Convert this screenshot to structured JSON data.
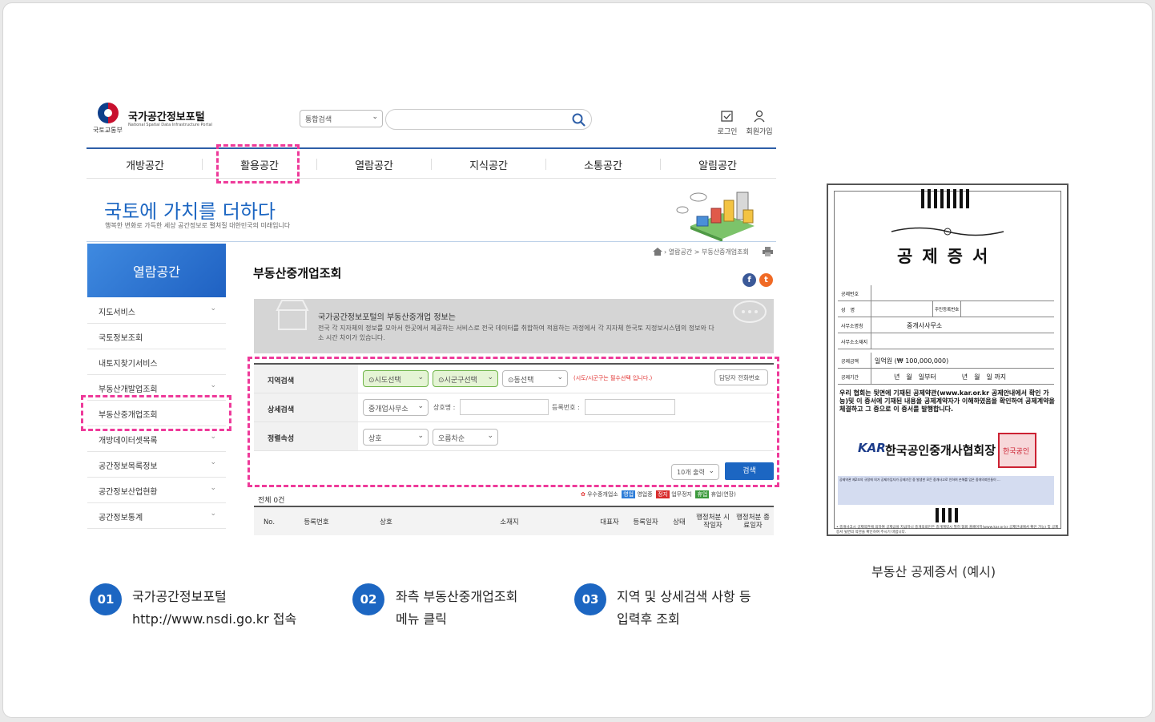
{
  "header": {
    "ministry": "국토교통부",
    "portal_name": "국가공간정보포털",
    "portal_en": "National Spatial Data Infrastructure Portal",
    "search_scope": "통합검색",
    "login": "로그인",
    "signup": "회원가입"
  },
  "nav": {
    "items": [
      "개방공간",
      "활용공간",
      "열람공간",
      "지식공간",
      "소통공간",
      "알림공간"
    ]
  },
  "banner": {
    "title": "국토에 가치를 더하다",
    "subtitle": "행복한 변화로 가득한 세상 공간정보로 펼쳐질 대한민국의 미래입니다"
  },
  "sidebar": {
    "title": "열람공간",
    "items": [
      "지도서비스",
      "국토정보조회",
      "내토지찾기서비스",
      "부동산개발업조회",
      "부동산중개업조회",
      "개방데이터셋목록",
      "공간정보목록정보",
      "공간정보산업현황",
      "공간정보통계"
    ]
  },
  "main": {
    "breadcrumb": "열람공간 > 부동산중개업조회",
    "title": "부동산중개업조회",
    "info_title": "국가공간정보포털의 부동산중개업 정보는",
    "info_text": "전국 각 지자체의 정보를 모아서 한곳에서 제공하는 서비스로 전국 데이터를 취합하여 적용하는 과정에서 각 지자체 한국토 지정보시스템의 정보와 다소 시간 차이가 있습니다.",
    "form": {
      "region_label": "지역검색",
      "sido": "시도선택",
      "sigungu": "시군구선택",
      "dong": "동선택",
      "required_note": "(시도/시군구는 필수선택 입니다.)",
      "contact_btn": "담당자 전화번호",
      "detail_label": "상세검색",
      "office_type": "중개업사무소",
      "name_label": "상호명 :",
      "reg_label": "등록번호 :",
      "sort_label": "정렬속성",
      "sort_field": "상호",
      "sort_order": "오름차순",
      "page_size": "10개 출력",
      "search_btn": "검색"
    },
    "legend": {
      "excellent": "우수중개업소",
      "open_badge": "영업",
      "open": "영업중",
      "stop_badge": "정지",
      "stop": "업무정지",
      "close_badge": "휴업",
      "close": "휴업(연장)"
    },
    "total": "전체 0건",
    "columns": [
      "No.",
      "등록번호",
      "상호",
      "소재지",
      "대표자",
      "등록일자",
      "상태",
      "행정처분 시작일자",
      "행정처분 종료일자"
    ]
  },
  "certificate": {
    "title": "공제증서",
    "rows": [
      {
        "k": "공제번호",
        "v": ""
      },
      {
        "k": "성　명",
        "v": "",
        "extra": "주민등록번호"
      },
      {
        "k": "사무소명칭",
        "v": "중개사사무소"
      },
      {
        "k": "사무소소재지",
        "v": ""
      },
      {
        "k": "공제금액",
        "v": "일억원 (₩ 100,000,000)"
      },
      {
        "k": "공제기간",
        "v": "년　월　일부터　　　　년　월　일 까지"
      }
    ],
    "body": "우리 협회는 뒷면에 기재된 공제약관(www.kar.or.kr 공제안내에서 확인 가능)및 이 증서에 기재된 내용을 공제계약자가 이해하였음을 확인하여 공제계약을 체결하고 그 증으로 이 증서를 발행합니다.",
    "logo": "KAR",
    "association": "한국공인중개사협회장",
    "seal_text": "한국공인",
    "fine_print": "공제약관 제2조의 규정에 의거 공제가입자가 공제기간 중 발생한 모든 중개사고로 인하여 손해를 입은 중개의뢰인들이 ...",
    "footer": "• 중개사고시 공제약관에 의하여 공제금을 지급하니 중개의뢰인은 중개계약시 필히 협회 홈페이지(www.kar.or.kr 공제안내에서 확인 가능) 및 공제증서 뒷면의 약관을 확인하여 주시기 바랍니다.",
    "caption": "부동산 공제증서 (예시)"
  },
  "steps": [
    {
      "num": "01",
      "line1": "국가공간정보포털",
      "line2": "http://www.nsdi.go.kr 접속"
    },
    {
      "num": "02",
      "line1": "좌측 부동산중개업조회",
      "line2": "메뉴 클릭"
    },
    {
      "num": "03",
      "line1": "지역 및 상세검색 사항 등",
      "line2": "입력후 조회"
    }
  ],
  "colors": {
    "accent": "#1c66c2",
    "highlight": "#ee3a9a",
    "nav_line": "#2e5fa8"
  }
}
